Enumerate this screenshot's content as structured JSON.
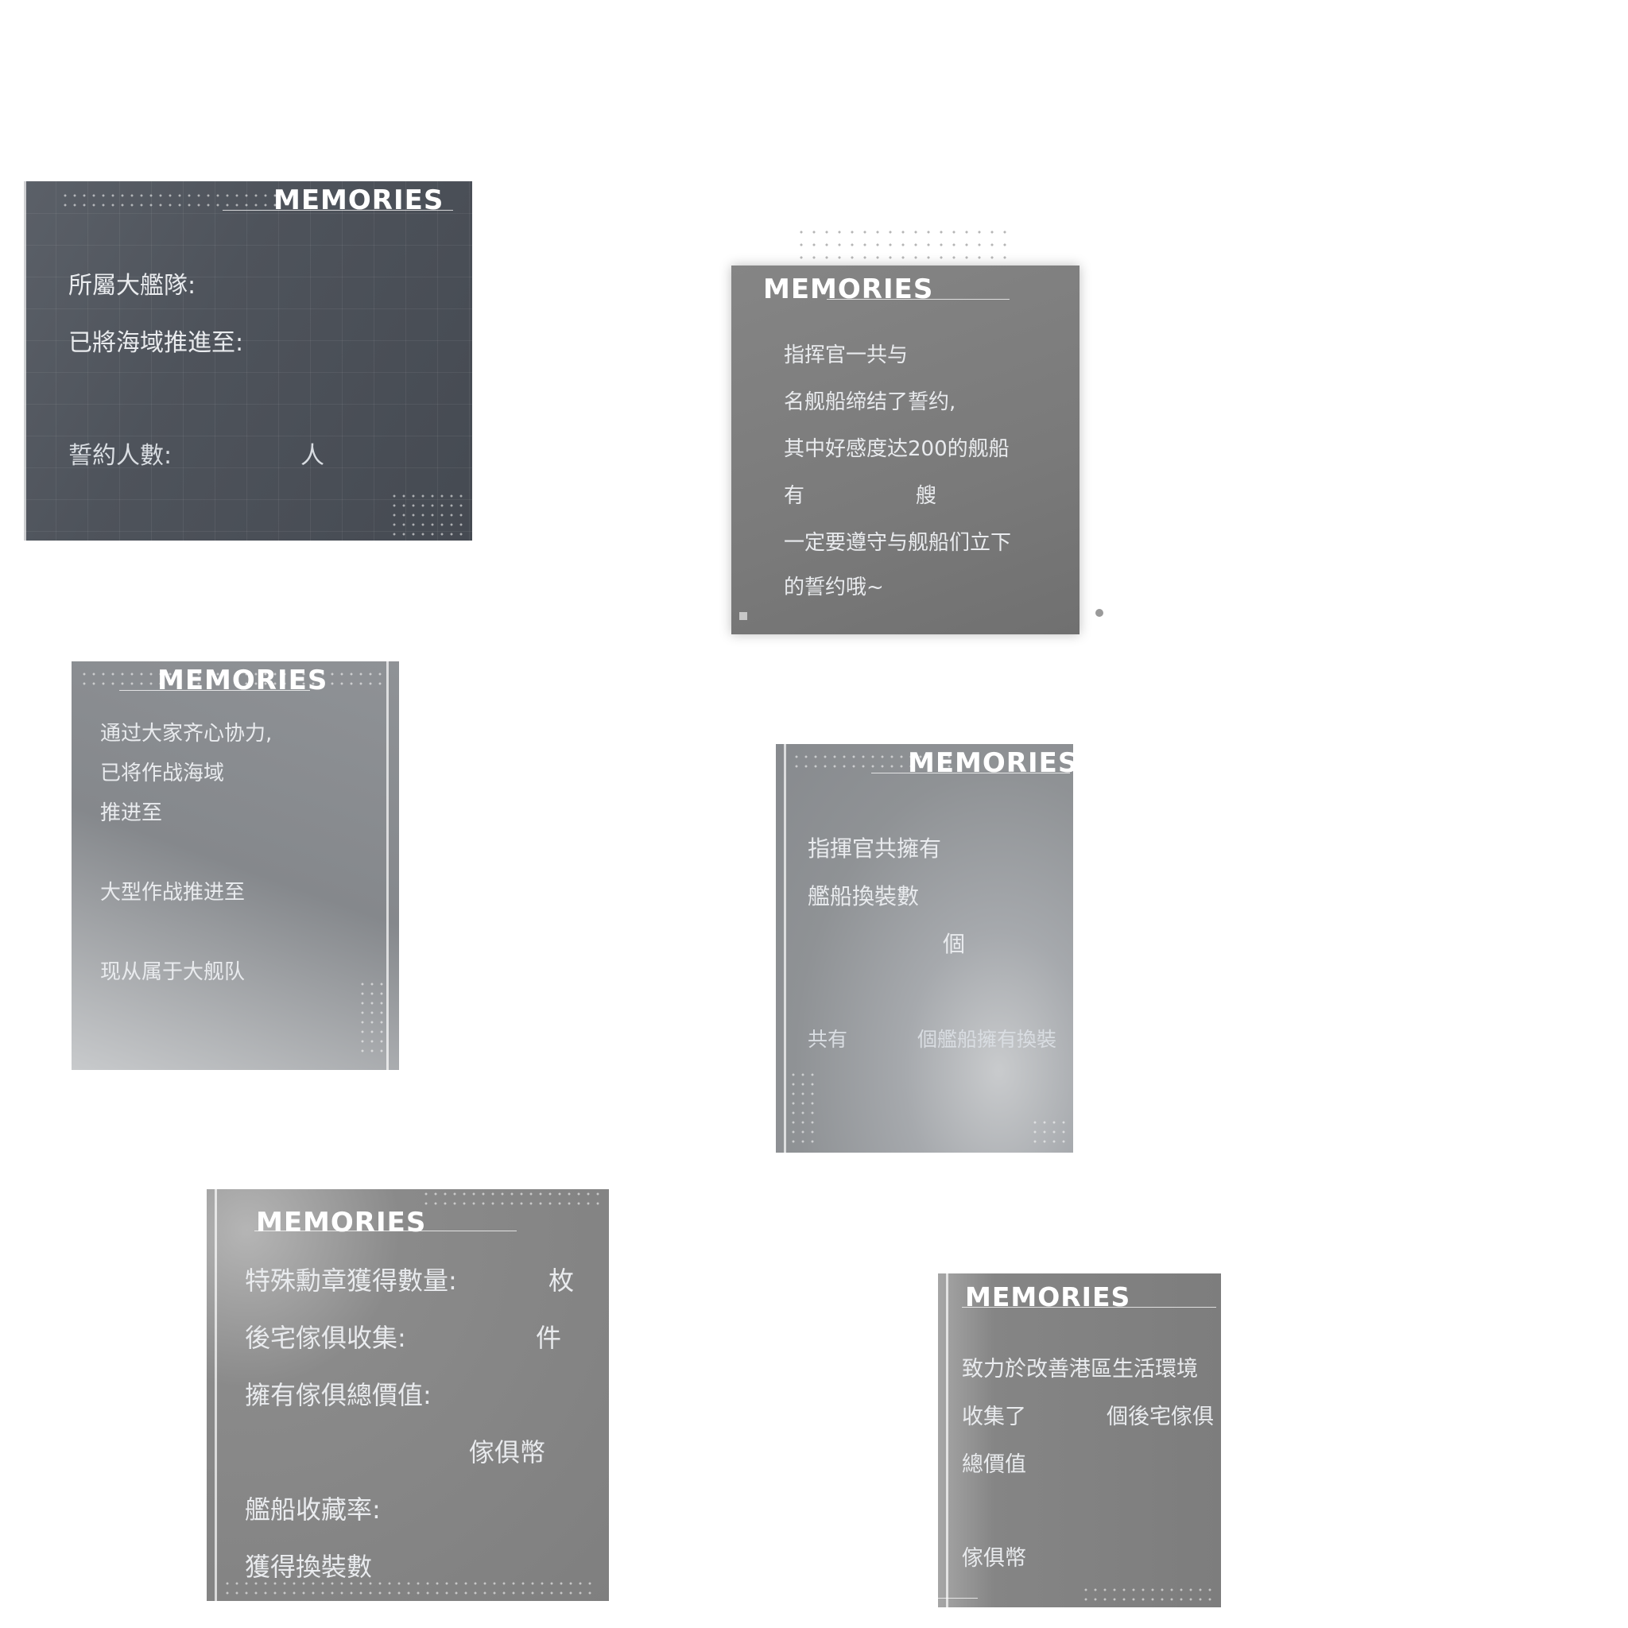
{
  "cards": [
    {
      "title": "MEMORIES",
      "lines": [
        "所屬大艦隊:",
        "已將海域推進至:",
        "誓約人數:",
        "人"
      ]
    },
    {
      "title": "MEMORIES",
      "lines": [
        "指挥官一共与",
        "名舰船缔结了誓约,",
        "其中好感度达200的舰船",
        "有",
        "艘",
        "一定要遵守与舰船们立下",
        "的誓约哦~"
      ]
    },
    {
      "title": "MEMORIES",
      "lines": [
        "通过大家齐心协力,",
        "已将作战海域",
        "推进至",
        "大型作战推进至",
        "现从属于大舰队"
      ]
    },
    {
      "title": "MEMORIES",
      "lines": [
        "指揮官共擁有",
        "艦船換裝數",
        "個",
        "共有",
        "個艦船擁有換裝"
      ]
    },
    {
      "title": "MEMORIES",
      "lines": [
        "特殊勳章獲得數量:",
        "枚",
        "後宅傢俱收集:",
        "件",
        "擁有傢俱總價值:",
        "傢俱幣",
        "艦船收藏率:",
        "獲得換裝數"
      ]
    },
    {
      "title": "MEMORIES",
      "lines": [
        "致力於改善港區生活環境",
        "收集了",
        "個後宅傢俱",
        "總價值",
        "傢俱幣"
      ]
    }
  ]
}
